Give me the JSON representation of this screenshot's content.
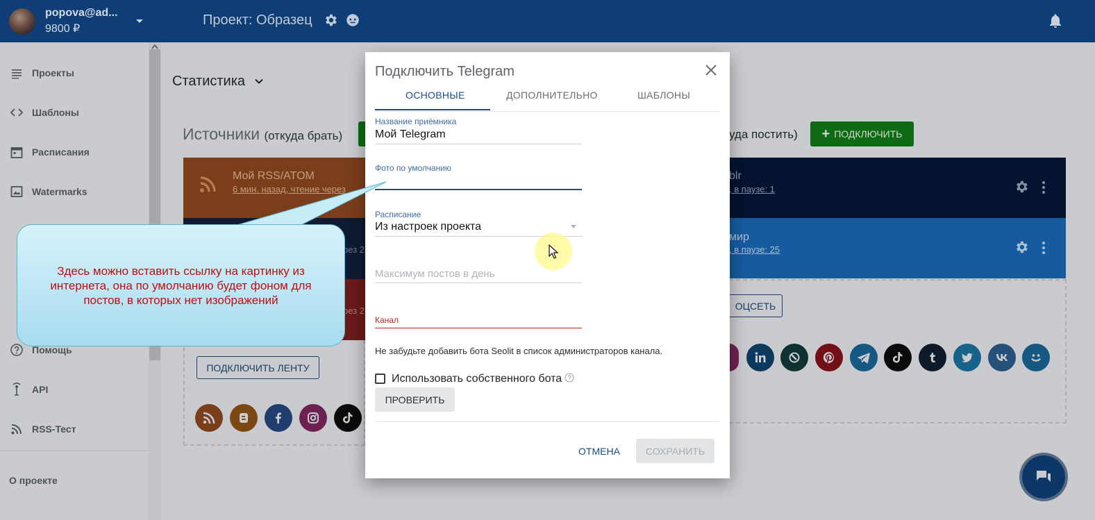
{
  "header": {
    "user_email": "popova@ad...",
    "balance": "9800 ₽",
    "project_title": "Проект: Образец"
  },
  "sidebar": {
    "items": [
      {
        "label": "Проекты",
        "icon": "list-icon"
      },
      {
        "label": "Шаблоны",
        "icon": "code-icon"
      },
      {
        "label": "Расписания",
        "icon": "calendar-icon"
      },
      {
        "label": "Watermarks",
        "icon": "image-icon"
      },
      {
        "label": "Помощь",
        "icon": "help-icon"
      },
      {
        "label": "API",
        "icon": "api-icon"
      },
      {
        "label": "RSS-Тест",
        "icon": "rss-icon"
      }
    ],
    "about": "О проекте"
  },
  "main": {
    "stat_title": "Статистика",
    "sources_title": "Источники",
    "sources_sub": "(откуда брать)",
    "targets_sub": "уда постить)",
    "connect_label": "ПОДКЛЮЧИТЬ",
    "rss_card": {
      "name": "Мой RSS/ATOM",
      "meta": "6 мин. назад, чтение через"
    },
    "dark_card_meta": "рез 2",
    "red_card_meta": "рез 2",
    "navy_card": {
      "name": "blr",
      "meta": ", в паузе: 1"
    },
    "blue_card": {
      "name": "мир",
      "meta": ", в паузе: 25"
    },
    "feed_button": "ПОДКЛЮЧИТЬ ЛЕНТУ",
    "soc_button": "ОЦСЕТЬ"
  },
  "modal": {
    "title": "Подключить Telegram",
    "tabs": [
      "ОСНОВНЫЕ",
      "ДОПОЛНИТЕЛЬНО",
      "ШАБЛОНЫ"
    ],
    "receiver_label": "Название приёмника",
    "receiver_value": "Мой Telegram",
    "photo_label": "Фото по умолчанию",
    "schedule_label": "Расписание",
    "schedule_value": "Из настроек проекта",
    "max_posts_placeholder": "Максимум постов в день",
    "channel_label": "Канал",
    "note": "Не забудьте добавить бота Seolit в список администраторов канала.",
    "own_bot_label": "Использовать собственного бота",
    "check_button": "ПРОВЕРИТЬ",
    "cancel_button": "ОТМЕНА",
    "save_button": "СОХРАНИТЬ"
  },
  "callout": {
    "text": "Здесь можно вставить ссылку на картинку из интернета, она по умолчанию будет фоном для постов, в которых нет изображений"
  },
  "colors": {
    "topbar": "#0e3e75",
    "accent": "#1b4d86",
    "green": "#0f6b13",
    "error": "#b22626",
    "callout_text": "#c20d0d"
  }
}
